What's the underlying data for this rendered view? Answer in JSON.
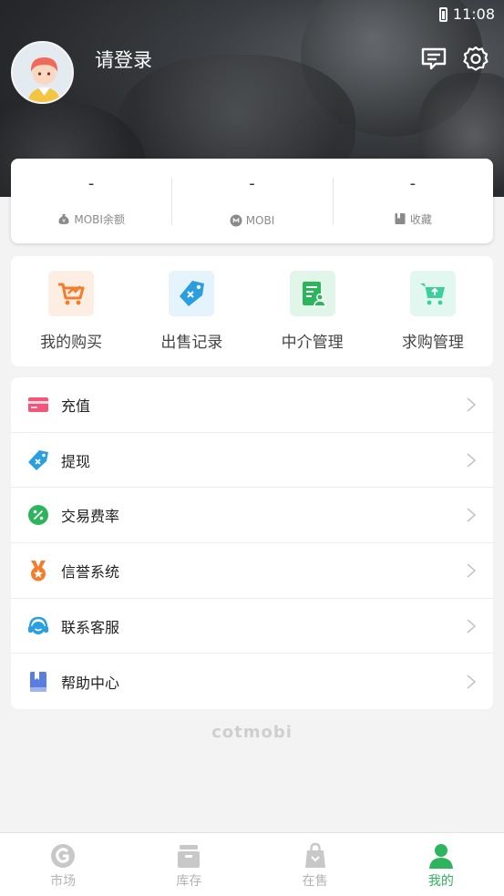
{
  "status": {
    "time": "11:08"
  },
  "header": {
    "login_text": "请登录",
    "message_icon": "message-icon",
    "settings_icon": "settings-gear-icon"
  },
  "stats": [
    {
      "value": "-",
      "label": "MOBI余额",
      "icon": "money-bag-icon"
    },
    {
      "value": "-",
      "label": "MOBI",
      "icon": "mobi-coin-icon"
    },
    {
      "value": "-",
      "label": "收藏",
      "icon": "bookmark-icon"
    }
  ],
  "quick_actions": [
    {
      "label": "我的购买",
      "icon": "shopping-cart-icon",
      "color": "#f57c2b"
    },
    {
      "label": "出售记录",
      "icon": "price-tag-icon",
      "color": "#2a9fe0"
    },
    {
      "label": "中介管理",
      "icon": "agent-document-icon",
      "color": "#2db55d"
    },
    {
      "label": "求购管理",
      "icon": "upload-cart-icon",
      "color": "#3ccf9c"
    }
  ],
  "menu": [
    {
      "label": "充值",
      "icon": "card-icon",
      "color": "#f0577a"
    },
    {
      "label": "提现",
      "icon": "tag-icon",
      "color": "#2a9fe0"
    },
    {
      "label": "交易费率",
      "icon": "percent-icon",
      "color": "#2db55d"
    },
    {
      "label": "信誉系统",
      "icon": "medal-icon",
      "color": "#f57c2b"
    },
    {
      "label": "联系客服",
      "icon": "headset-icon",
      "color": "#2a9fe0"
    },
    {
      "label": "帮助中心",
      "icon": "book-icon",
      "color": "#5a7de0"
    }
  ],
  "brand": "cotmobi",
  "tabs": [
    {
      "label": "市场",
      "icon": "market-icon",
      "active": false
    },
    {
      "label": "库存",
      "icon": "inventory-icon",
      "active": false
    },
    {
      "label": "在售",
      "icon": "shopping-bag-icon",
      "active": false
    },
    {
      "label": "我的",
      "icon": "profile-icon",
      "active": true
    }
  ],
  "colors": {
    "accent": "#2db55d",
    "inactive": "#b3b3b3"
  }
}
